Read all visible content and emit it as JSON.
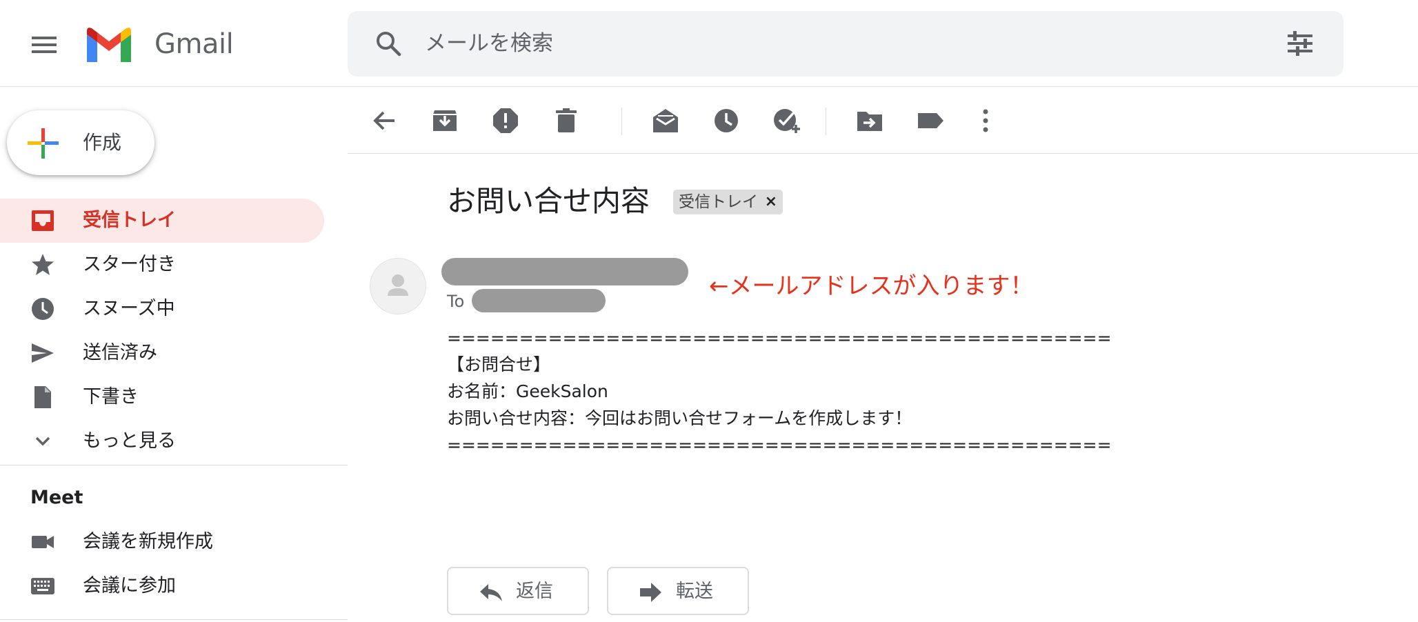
{
  "header": {
    "app_name": "Gmail",
    "search_placeholder": "メールを検索"
  },
  "sidebar": {
    "compose_label": "作成",
    "items": [
      {
        "label": "受信トレイ",
        "icon": "inbox-icon",
        "active": true
      },
      {
        "label": "スター付き",
        "icon": "star-icon"
      },
      {
        "label": "スヌーズ中",
        "icon": "clock-icon"
      },
      {
        "label": "送信済み",
        "icon": "send-icon"
      },
      {
        "label": "下書き",
        "icon": "draft-icon"
      },
      {
        "label": "もっと見る",
        "icon": "chevron-down-icon"
      }
    ],
    "meet": {
      "title": "Meet",
      "items": [
        {
          "label": "会議を新規作成",
          "icon": "videocam-icon"
        },
        {
          "label": "会議に参加",
          "icon": "keyboard-icon"
        }
      ]
    }
  },
  "toolbar": {
    "buttons": [
      "back-arrow-icon",
      "archive-icon",
      "report-spam-icon",
      "delete-icon",
      "mark-unread-icon",
      "snooze-icon",
      "add-to-tasks-icon",
      "move-to-icon",
      "label-icon",
      "more-vert-icon"
    ]
  },
  "message": {
    "subject": "お問い合せ内容",
    "label_chip": "受信トレイ",
    "chip_close": "×",
    "to_label": "To",
    "annotation": "←メールアドレスが入ります！",
    "body_lines": [
      "==============================================",
      "【お問合せ】",
      "お名前：GeekSalon",
      "お問い合せ内容：今回はお問い合せフォームを作成します！",
      "=============================================="
    ],
    "reply_label": "返信",
    "forward_label": "転送"
  },
  "colors": {
    "accent_red": "#d93025",
    "active_bg": "#fce8e6",
    "annotation_red": "#e8311b",
    "search_bg": "#f1f3f4"
  }
}
